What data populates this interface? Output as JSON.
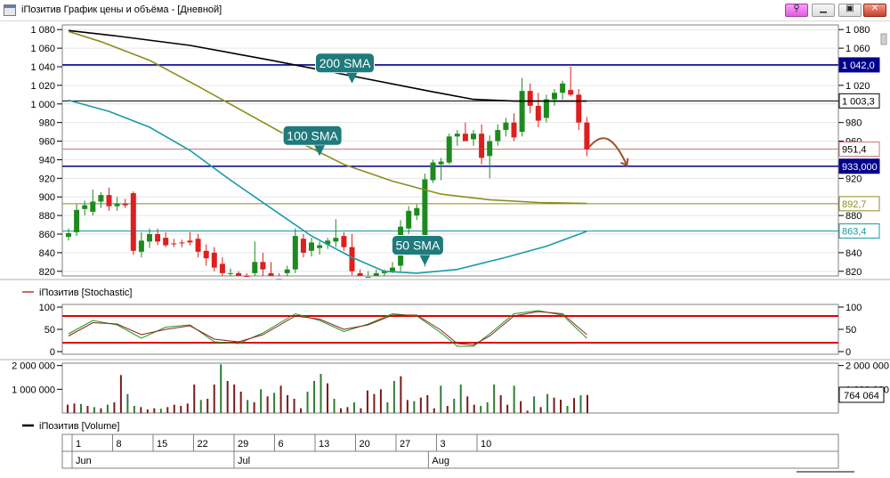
{
  "window": {
    "title": "iПозитив График цены и объёма - [Дневной]",
    "pin_icon": "pin-icon",
    "minimize_icon": "minimize-icon",
    "maximize_icon": "maximize-icon",
    "close_icon": "close-icon"
  },
  "colors": {
    "bullish": "#1e8a1e",
    "bearish": "#dd1f1f",
    "sma200": "#000000",
    "sma100": "#8c8c1c",
    "sma50": "#1b9aa5",
    "level_line": "#00008b",
    "annotation_bg": "#1f7a7c",
    "arrow": "#a0522d",
    "volume_up": "#2e7d32",
    "volume_down": "#7b1a1a",
    "stoch_band": "#e00000",
    "grid": "#e6e6e6"
  },
  "chart_data": [
    {
      "id": "price",
      "type": "candlestick",
      "y_ticks": [
        "1 080",
        "1 060",
        "1 040",
        "1 020",
        "1 000",
        "980",
        "960",
        "940",
        "920",
        "900",
        "880",
        "860",
        "840",
        "820"
      ],
      "y_tick_values": [
        1080,
        1060,
        1040,
        1020,
        1000,
        980,
        960,
        940,
        920,
        900,
        880,
        860,
        840,
        820
      ],
      "right_y_ticks": [
        "1 080",
        "1 060",
        "1 020",
        "980",
        "960",
        "920",
        "880",
        "840",
        "820"
      ],
      "right_y_tick_values": [
        1080,
        1060,
        1020,
        980,
        960,
        920,
        880,
        840,
        820
      ],
      "ylim": [
        815,
        1085
      ],
      "x_labels": [
        "1",
        "8",
        "15",
        "22",
        "29",
        "6",
        "13",
        "20",
        "27",
        "3",
        "10"
      ],
      "x_label_bar_index": [
        0,
        5,
        10,
        15,
        20,
        25,
        30,
        35,
        40,
        45,
        50
      ],
      "month_labels": [
        "Jun",
        "Jul",
        "Aug"
      ],
      "month_bar_index": [
        0,
        20,
        44
      ],
      "candles": [
        {
          "o": 857,
          "h": 866,
          "l": 853,
          "c": 861
        },
        {
          "o": 862,
          "h": 892,
          "l": 858,
          "c": 886
        },
        {
          "o": 887,
          "h": 896,
          "l": 880,
          "c": 891
        },
        {
          "o": 884,
          "h": 908,
          "l": 880,
          "c": 895
        },
        {
          "o": 895,
          "h": 905,
          "l": 888,
          "c": 902
        },
        {
          "o": 902,
          "h": 910,
          "l": 885,
          "c": 890
        },
        {
          "o": 890,
          "h": 900,
          "l": 885,
          "c": 893
        },
        {
          "o": 893,
          "h": 898,
          "l": 888,
          "c": 891
        },
        {
          "o": 904,
          "h": 906,
          "l": 838,
          "c": 842
        },
        {
          "o": 841,
          "h": 862,
          "l": 835,
          "c": 853
        },
        {
          "o": 852,
          "h": 866,
          "l": 845,
          "c": 860
        },
        {
          "o": 860,
          "h": 866,
          "l": 848,
          "c": 852
        },
        {
          "o": 856,
          "h": 862,
          "l": 846,
          "c": 848
        },
        {
          "o": 850,
          "h": 855,
          "l": 846,
          "c": 849
        },
        {
          "o": 851,
          "h": 854,
          "l": 846,
          "c": 850
        },
        {
          "o": 853,
          "h": 862,
          "l": 848,
          "c": 851
        },
        {
          "o": 855,
          "h": 860,
          "l": 835,
          "c": 841
        },
        {
          "o": 842,
          "h": 849,
          "l": 826,
          "c": 834
        },
        {
          "o": 840,
          "h": 846,
          "l": 820,
          "c": 824
        },
        {
          "o": 828,
          "h": 835,
          "l": 812,
          "c": 818
        },
        {
          "o": 818,
          "h": 823,
          "l": 812,
          "c": 818
        },
        {
          "o": 818,
          "h": 820,
          "l": 808,
          "c": 812
        },
        {
          "o": 815,
          "h": 818,
          "l": 808,
          "c": 810
        },
        {
          "o": 818,
          "h": 852,
          "l": 812,
          "c": 830
        },
        {
          "o": 830,
          "h": 840,
          "l": 815,
          "c": 822
        },
        {
          "o": 818,
          "h": 830,
          "l": 808,
          "c": 812
        },
        {
          "o": 812,
          "h": 818,
          "l": 806,
          "c": 810
        },
        {
          "o": 818,
          "h": 826,
          "l": 815,
          "c": 822
        },
        {
          "o": 822,
          "h": 866,
          "l": 818,
          "c": 858
        },
        {
          "o": 855,
          "h": 860,
          "l": 835,
          "c": 840
        },
        {
          "o": 842,
          "h": 856,
          "l": 836,
          "c": 851
        },
        {
          "o": 845,
          "h": 852,
          "l": 838,
          "c": 848
        },
        {
          "o": 849,
          "h": 856,
          "l": 844,
          "c": 853
        },
        {
          "o": 852,
          "h": 876,
          "l": 846,
          "c": 856
        },
        {
          "o": 858,
          "h": 862,
          "l": 842,
          "c": 846
        },
        {
          "o": 846,
          "h": 860,
          "l": 816,
          "c": 820
        },
        {
          "o": 818,
          "h": 822,
          "l": 808,
          "c": 812
        },
        {
          "o": 812,
          "h": 820,
          "l": 808,
          "c": 814
        },
        {
          "o": 814,
          "h": 822,
          "l": 810,
          "c": 818
        },
        {
          "o": 818,
          "h": 822,
          "l": 812,
          "c": 820
        },
        {
          "o": 820,
          "h": 830,
          "l": 818,
          "c": 824
        },
        {
          "o": 826,
          "h": 875,
          "l": 820,
          "c": 868
        },
        {
          "o": 866,
          "h": 890,
          "l": 860,
          "c": 885
        },
        {
          "o": 880,
          "h": 892,
          "l": 875,
          "c": 888
        },
        {
          "o": 858,
          "h": 925,
          "l": 825,
          "c": 919
        },
        {
          "o": 918,
          "h": 940,
          "l": 915,
          "c": 937
        },
        {
          "o": 935,
          "h": 942,
          "l": 918,
          "c": 938
        },
        {
          "o": 937,
          "h": 968,
          "l": 935,
          "c": 965
        },
        {
          "o": 965,
          "h": 972,
          "l": 955,
          "c": 968
        },
        {
          "o": 968,
          "h": 980,
          "l": 962,
          "c": 960
        },
        {
          "o": 962,
          "h": 972,
          "l": 955,
          "c": 968
        },
        {
          "o": 968,
          "h": 978,
          "l": 935,
          "c": 942
        },
        {
          "o": 944,
          "h": 966,
          "l": 920,
          "c": 960
        },
        {
          "o": 960,
          "h": 978,
          "l": 955,
          "c": 972
        },
        {
          "o": 972,
          "h": 985,
          "l": 965,
          "c": 980
        },
        {
          "o": 980,
          "h": 990,
          "l": 960,
          "c": 964
        },
        {
          "o": 970,
          "h": 1028,
          "l": 965,
          "c": 1014
        },
        {
          "o": 1014,
          "h": 1022,
          "l": 990,
          "c": 998
        },
        {
          "o": 998,
          "h": 1012,
          "l": 975,
          "c": 982
        },
        {
          "o": 985,
          "h": 1010,
          "l": 980,
          "c": 1005
        },
        {
          "o": 1005,
          "h": 1016,
          "l": 998,
          "c": 1012
        },
        {
          "o": 1012,
          "h": 1025,
          "l": 1005,
          "c": 1022
        },
        {
          "o": 1015,
          "h": 1040,
          "l": 1008,
          "c": 1010
        },
        {
          "o": 1010,
          "h": 1016,
          "l": 972,
          "c": 980
        },
        {
          "o": 980,
          "h": 986,
          "l": 944,
          "c": 951
        }
      ],
      "sma200": [
        {
          "i": 0,
          "v": 1079
        },
        {
          "i": 6,
          "v": 1073
        },
        {
          "i": 15,
          "v": 1063
        },
        {
          "i": 25,
          "v": 1047
        },
        {
          "i": 35,
          "v": 1030
        },
        {
          "i": 45,
          "v": 1013
        },
        {
          "i": 50,
          "v": 1005
        },
        {
          "i": 55,
          "v": 1003
        },
        {
          "i": 64,
          "v": 1003
        }
      ],
      "sma100": [
        {
          "i": 0,
          "v": 1078
        },
        {
          "i": 4,
          "v": 1067
        },
        {
          "i": 10,
          "v": 1047
        },
        {
          "i": 16,
          "v": 1019
        },
        {
          "i": 22,
          "v": 990
        },
        {
          "i": 28,
          "v": 961
        },
        {
          "i": 34,
          "v": 935
        },
        {
          "i": 40,
          "v": 917
        },
        {
          "i": 46,
          "v": 903
        },
        {
          "i": 52,
          "v": 897
        },
        {
          "i": 58,
          "v": 894
        },
        {
          "i": 64,
          "v": 893
        }
      ],
      "sma50": [
        {
          "i": 0,
          "v": 1004
        },
        {
          "i": 5,
          "v": 992
        },
        {
          "i": 10,
          "v": 975
        },
        {
          "i": 15,
          "v": 950
        },
        {
          "i": 20,
          "v": 918
        },
        {
          "i": 25,
          "v": 888
        },
        {
          "i": 30,
          "v": 858
        },
        {
          "i": 35,
          "v": 835
        },
        {
          "i": 39,
          "v": 820
        },
        {
          "i": 43,
          "v": 818
        },
        {
          "i": 48,
          "v": 822
        },
        {
          "i": 54,
          "v": 835
        },
        {
          "i": 59,
          "v": 847
        },
        {
          "i": 64,
          "v": 863
        }
      ],
      "horizontal_lines": [
        {
          "value": 1042,
          "label": "1 042,0",
          "style": "level",
          "bold": true
        },
        {
          "value": 1003.3,
          "label": "1 003,3",
          "style": "sma200"
        },
        {
          "value": 951.4,
          "label": "951,4",
          "style": "price"
        },
        {
          "value": 933,
          "label": "933,000",
          "style": "level",
          "bold": true
        },
        {
          "value": 892.7,
          "label": "892,7",
          "style": "sma100"
        },
        {
          "value": 863.4,
          "label": "863,4",
          "style": "sma50"
        }
      ],
      "annotations": [
        {
          "text": "200 SMA",
          "at_bar": 35,
          "at_value": 1022
        },
        {
          "text": "100 SMA",
          "at_bar": 31,
          "at_value": 944
        },
        {
          "text": "50 SMA",
          "at_bar": 44,
          "at_value": 826
        }
      ]
    },
    {
      "id": "stochastic",
      "type": "line",
      "legend": "iПозитив [Stochastic]",
      "y_ticks": [
        "100",
        "50",
        "0"
      ],
      "y_tick_values": [
        100,
        50,
        0
      ],
      "ylim": [
        -6,
        106
      ],
      "band_levels": [
        80,
        20
      ],
      "series": [
        {
          "color": "#1a9a1a",
          "points": [
            {
              "i": 0,
              "v": 40
            },
            {
              "i": 3,
              "v": 70
            },
            {
              "i": 6,
              "v": 60
            },
            {
              "i": 9,
              "v": 30
            },
            {
              "i": 12,
              "v": 55
            },
            {
              "i": 15,
              "v": 60
            },
            {
              "i": 18,
              "v": 22
            },
            {
              "i": 21,
              "v": 18
            },
            {
              "i": 24,
              "v": 42
            },
            {
              "i": 28,
              "v": 85
            },
            {
              "i": 31,
              "v": 70
            },
            {
              "i": 34,
              "v": 45
            },
            {
              "i": 37,
              "v": 62
            },
            {
              "i": 40,
              "v": 85
            },
            {
              "i": 43,
              "v": 80
            },
            {
              "i": 46,
              "v": 42
            },
            {
              "i": 48,
              "v": 12
            },
            {
              "i": 50,
              "v": 12
            },
            {
              "i": 52,
              "v": 40
            },
            {
              "i": 55,
              "v": 85
            },
            {
              "i": 58,
              "v": 92
            },
            {
              "i": 61,
              "v": 82
            },
            {
              "i": 64,
              "v": 30
            }
          ]
        },
        {
          "color": "#8b2020",
          "points": [
            {
              "i": 0,
              "v": 35
            },
            {
              "i": 3,
              "v": 65
            },
            {
              "i": 6,
              "v": 62
            },
            {
              "i": 9,
              "v": 38
            },
            {
              "i": 12,
              "v": 50
            },
            {
              "i": 15,
              "v": 58
            },
            {
              "i": 18,
              "v": 28
            },
            {
              "i": 21,
              "v": 22
            },
            {
              "i": 24,
              "v": 38
            },
            {
              "i": 28,
              "v": 80
            },
            {
              "i": 31,
              "v": 73
            },
            {
              "i": 34,
              "v": 50
            },
            {
              "i": 37,
              "v": 60
            },
            {
              "i": 40,
              "v": 82
            },
            {
              "i": 43,
              "v": 82
            },
            {
              "i": 46,
              "v": 48
            },
            {
              "i": 48,
              "v": 18
            },
            {
              "i": 50,
              "v": 15
            },
            {
              "i": 52,
              "v": 35
            },
            {
              "i": 55,
              "v": 80
            },
            {
              "i": 58,
              "v": 90
            },
            {
              "i": 61,
              "v": 85
            },
            {
              "i": 64,
              "v": 38
            }
          ]
        }
      ]
    },
    {
      "id": "volume",
      "type": "bar",
      "legend": "iПозитив [Volume]",
      "y_ticks": [
        "2 000 000",
        "1 000 000"
      ],
      "y_tick_values": [
        2000000,
        1000000
      ],
      "right_y_ticks": [
        "2 000 000",
        "1 000 000"
      ],
      "ylim": [
        0,
        2100000
      ],
      "last_value_label": "764 064",
      "values": [
        350000,
        400000,
        380000,
        300000,
        250000,
        200000,
        350000,
        450000,
        1600000,
        800000,
        300000,
        250000,
        150000,
        200000,
        180000,
        250000,
        350000,
        300000,
        400000,
        1200000,
        550000,
        600000,
        1200000,
        2050000,
        1350000,
        1200000,
        900000,
        550000,
        450000,
        1000000,
        700000,
        850000,
        1150000,
        750000,
        600000,
        200000,
        900000,
        1350000,
        1650000,
        1250000,
        600000,
        200000,
        250000,
        450000,
        200000,
        950000,
        800000,
        1000000,
        450000,
        1350000,
        1550000,
        550000,
        500000,
        650000,
        750000,
        200000,
        1150000,
        300000,
        600000,
        1200000,
        700000,
        350000,
        300000,
        450000,
        1200000,
        750000,
        350000,
        1150000,
        500000,
        100000,
        700000,
        250000,
        800000,
        650000,
        560000,
        300000,
        630000,
        750000,
        760000
      ],
      "directions": [
        "d",
        "d",
        "u",
        "d",
        "u",
        "d",
        "u",
        "d",
        "d",
        "u",
        "u",
        "d",
        "d",
        "d",
        "u",
        "d",
        "d",
        "d",
        "d",
        "d",
        "u",
        "d",
        "d",
        "u",
        "d",
        "d",
        "d",
        "u",
        "d",
        "u",
        "d",
        "u",
        "d",
        "d",
        "d",
        "d",
        "u",
        "u",
        "u",
        "d",
        "u",
        "d",
        "d",
        "u",
        "d",
        "d",
        "d",
        "d",
        "u",
        "u",
        "d",
        "d",
        "u",
        "d",
        "d",
        "d",
        "u",
        "d",
        "u",
        "u",
        "d",
        "d",
        "u",
        "u",
        "u",
        "d",
        "d",
        "u",
        "d",
        "d",
        "u",
        "d",
        "u",
        "d",
        "d",
        "u",
        "d",
        "u",
        "d"
      ]
    }
  ]
}
